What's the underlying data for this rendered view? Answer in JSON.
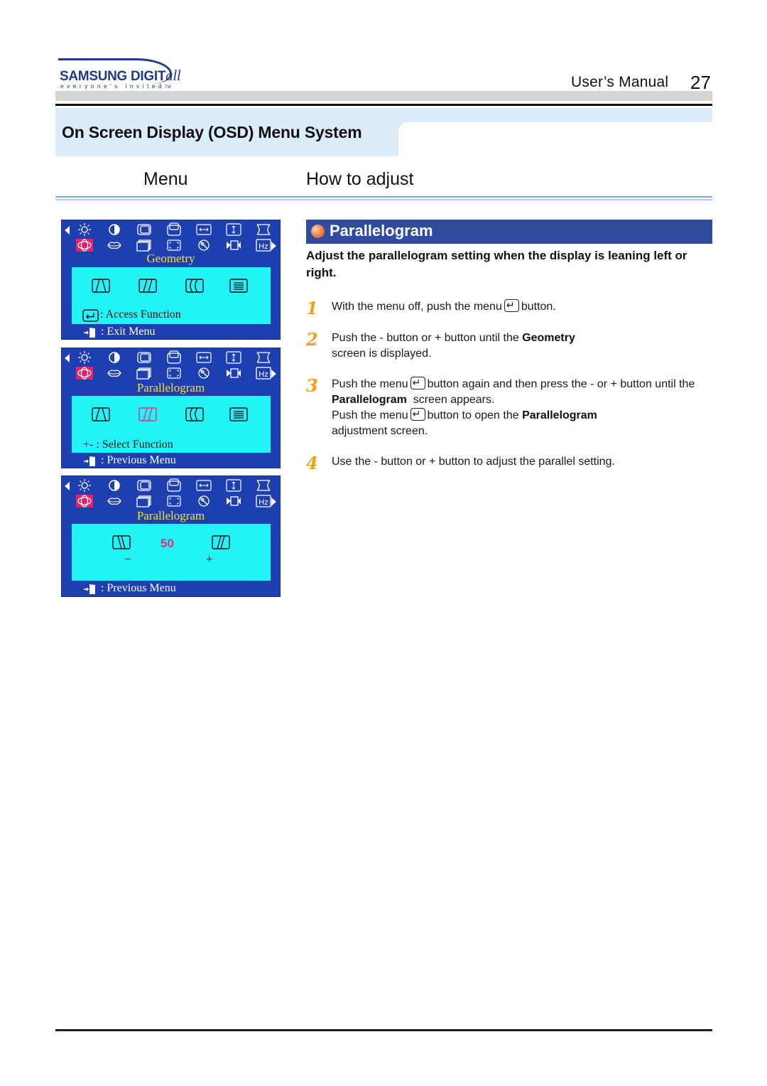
{
  "header": {
    "brand": "SAMSUNG DIGIT",
    "brand_script": "all",
    "tagline": "everyone's invited",
    "tagline_tm": "TM",
    "manual_label": "User’s  Manual",
    "page_number": "27"
  },
  "section": {
    "title": "On Screen Display (OSD) Menu System"
  },
  "columns": {
    "menu": "Menu",
    "how_to": "How to adjust"
  },
  "osd_icons_row1": [
    "brightness-icon",
    "contrast-icon",
    "h-position-icon",
    "v-position-icon",
    "h-size-icon",
    "v-size-icon",
    "pincushion-icon"
  ],
  "osd_icons_row2": [
    "geometry-icon",
    "color-icon",
    "recall-icon",
    "zoom-icon",
    "degauss-icon",
    "moire-icon",
    "display-mode-hz-icon"
  ],
  "osd_panels": [
    {
      "title": "Geometry",
      "sub_icons": [
        "trapezoid-icon",
        "parallelogram-icon",
        "pinbalance-icon",
        "rotation-icon"
      ],
      "highlighted_sub": null,
      "hint_label": ": Access Function",
      "footer_label": ": Exit Menu"
    },
    {
      "title": "Parallelogram",
      "sub_icons": [
        "trapezoid-icon",
        "parallelogram-icon",
        "pinbalance-icon",
        "rotation-icon"
      ],
      "highlighted_sub": "parallelogram-icon",
      "hint_prefix": "+-",
      "hint_label": ": Select Function",
      "footer_label": ": Previous Menu"
    },
    {
      "title": "Parallelogram",
      "value": "50",
      "minus_label": "−",
      "plus_label": "+",
      "footer_label": ": Previous Menu"
    }
  ],
  "parameter": {
    "title": "Parallelogram",
    "intro": "Adjust the parallelogram setting when the display is leaning left or right."
  },
  "steps": [
    {
      "number": "1",
      "parts": [
        "With the menu off, push the menu",
        "button."
      ]
    },
    {
      "number": "2",
      "parts": [
        "Push the  - button or + button until the",
        "Geometry",
        "screen is displayed."
      ]
    },
    {
      "number": "3",
      "parts": [
        "Push the menu",
        "button again and then press the - or + button until the",
        "Parallelogram",
        "screen appears.",
        "Push the menu",
        "button to open the",
        "Parallelogram",
        "adjustment screen."
      ]
    },
    {
      "number": "4",
      "parts": [
        "Use the  - button or + button to adjust the parallel setting."
      ]
    }
  ],
  "colors": {
    "osd_background": "#1e3fb0",
    "osd_screen": "#22f3f6",
    "osd_title": "#f2e23a",
    "osd_selected": "#e8206a",
    "header_band": "#2f4b9d",
    "section_band": "#dcecfb",
    "step_number": "#f2a20c"
  }
}
